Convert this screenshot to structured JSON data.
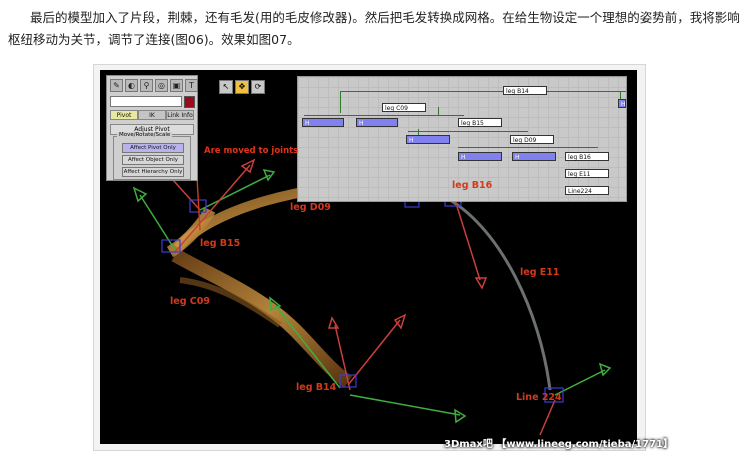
{
  "article": {
    "text": "最后的模型加入了片段，荆棘，还有毛发(用的毛皮修改器)。然后把毛发转换成网格。在给生物设定一个理想的姿势前，我将影响枢纽移动为关节，调节了连接(图06)。效果如图07。"
  },
  "command_panel": {
    "icons": [
      "create-icon",
      "modify-icon",
      "hierarchy-icon",
      "motion-icon",
      "display-icon",
      "utilities-icon"
    ],
    "icon_glyphs": [
      "✎",
      "◐",
      "⚲",
      "◎",
      "▣",
      "T"
    ],
    "swatch_color": "#9a0c1c",
    "tabs": [
      "Pivot",
      "IK",
      "Link Info"
    ],
    "active_tab": "Pivot",
    "rollout_title": "Adjust Pivot",
    "group_title": "Move/Rotate/Scale",
    "buttons": [
      "Affect Pivot Only",
      "Affect Object Only",
      "Affect Hierarchy Only"
    ],
    "active_button": "Affect Pivot Only"
  },
  "toolbar": {
    "buttons": [
      "select-arrow-icon",
      "move-icon",
      "rotate-icon"
    ],
    "glyphs": [
      "↖",
      "✥",
      "⟳"
    ]
  },
  "schematic": {
    "nodes_white": [
      "leg B14",
      "leg C09",
      "leg B15",
      "leg D09",
      "leg B16",
      "leg E11",
      "Line224"
    ],
    "nodes_blue_label": "H"
  },
  "annotation": "Are moved to joints",
  "labels": {
    "leg_d09": "leg D09",
    "leg_b16": "leg B16",
    "leg_b15": "leg B15",
    "leg_c09": "leg C09",
    "leg_e11": "leg E11",
    "leg_b14": "leg B14",
    "line_224": "Line 224"
  },
  "watermark": "3Dmax吧 【www.lineeg.com/tieba/1771】",
  "colors": {
    "label_red": "#d23a1c",
    "gizmo_green": "#3fae3f",
    "gizmo_red": "#c8403c",
    "gizmo_blue": "#3d3dd0",
    "branch": "#c9903a"
  }
}
